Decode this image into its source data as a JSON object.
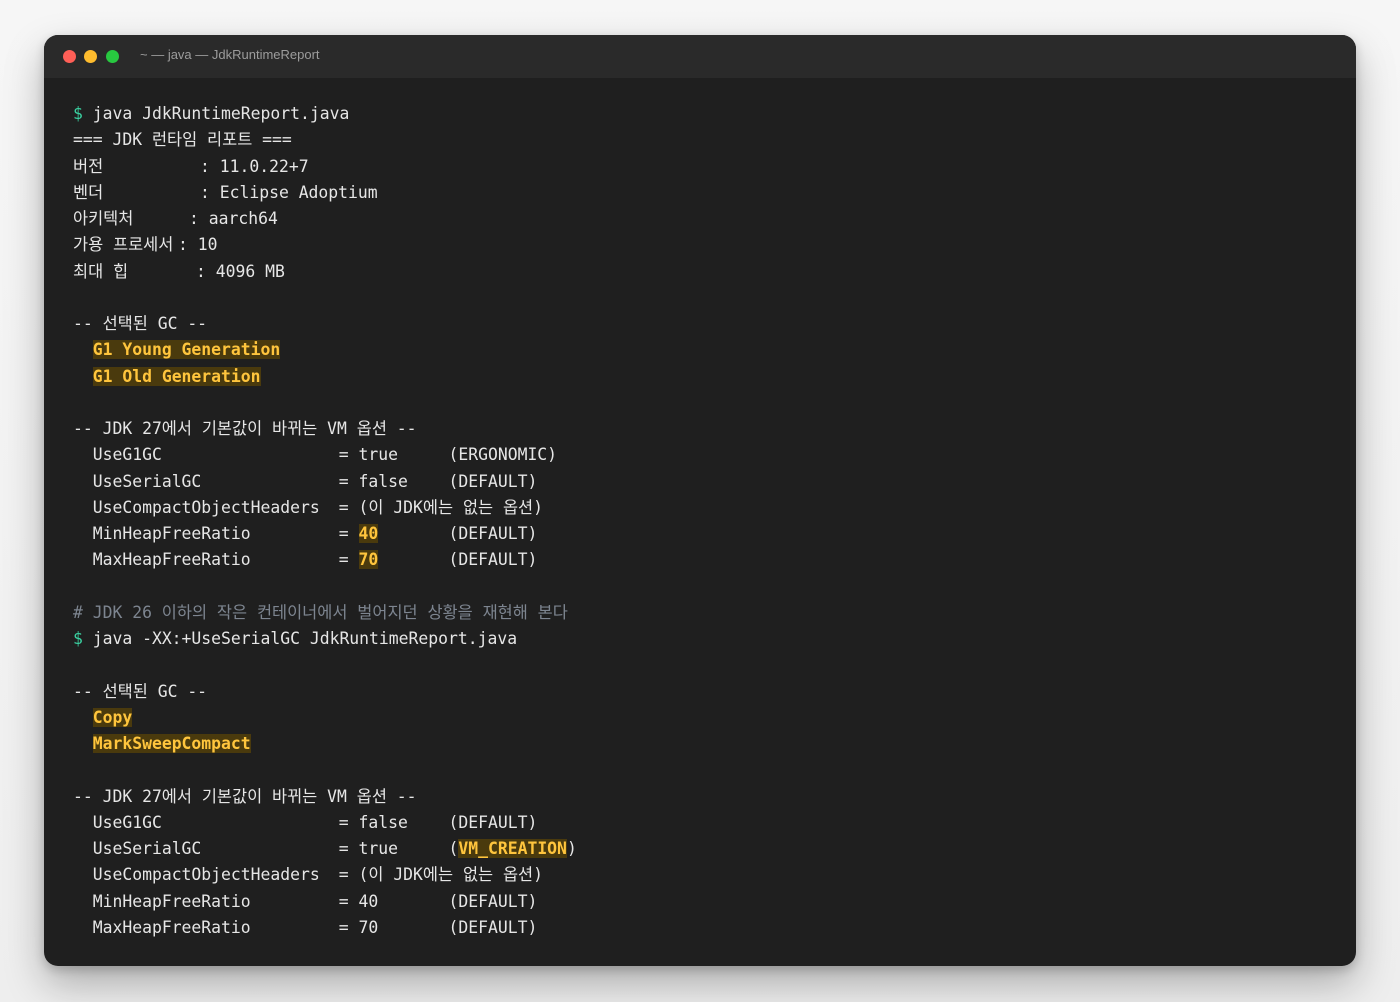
{
  "window": {
    "title": "~ — java — JdkRuntimeReport"
  },
  "terminal": {
    "cmd1": {
      "prompt": "$",
      "command": " java JdkRuntimeReport.java"
    },
    "report_header": "=== JDK 런타임 리포트 ===",
    "report": [
      {
        "label": "버전",
        "sep": ": ",
        "value": "11.0.22+7"
      },
      {
        "label": "벤더",
        "sep": ": ",
        "value": "Eclipse Adoptium"
      },
      {
        "label": "아키텍처",
        "sep": ": ",
        "value": "aarch64"
      },
      {
        "label": "가용 프로세서",
        "sep": ": ",
        "value": "10"
      },
      {
        "label": "최대 힙",
        "sep": ": ",
        "value": "4096 MB"
      }
    ],
    "gc_header_1": "-- 선택된 GC --",
    "gc_list_1": [
      "G1 Young Generation",
      "G1 Old Generation"
    ],
    "vm_header_1": "-- JDK 27에서 기본값이 바뀌는 VM 옵션 --",
    "vm_options_1": [
      {
        "name": "UseG1GC",
        "eq": "= ",
        "value": "true",
        "origin": "(ERGONOMIC)"
      },
      {
        "name": "UseSerialGC",
        "eq": "= ",
        "value": "false",
        "origin": "(DEFAULT)"
      },
      {
        "name": "UseCompactObjectHeaders",
        "eq": "= ",
        "value": "(이 JDK에는 없는 옵션)",
        "origin": ""
      },
      {
        "name": "MinHeapFreeRatio",
        "eq": "= ",
        "value": "40",
        "origin": "(DEFAULT)"
      },
      {
        "name": "MaxHeapFreeRatio",
        "eq": "= ",
        "value": "70",
        "origin": "(DEFAULT)"
      }
    ],
    "comment": "# JDK 26 이하의 작은 컨테이너에서 벌어지던 상황을 재현해 본다",
    "cmd2": {
      "prompt": "$",
      "command": " java -XX:+UseSerialGC JdkRuntimeReport.java"
    },
    "gc_header_2": "-- 선택된 GC --",
    "gc_list_2": [
      "Copy",
      "MarkSweepCompact"
    ],
    "vm_header_2": "-- JDK 27에서 기본값이 바뀌는 VM 옵션 --",
    "vm_options_2": [
      {
        "name": "UseG1GC",
        "eq": "= ",
        "value": "false",
        "origin": "(DEFAULT)"
      },
      {
        "name": "UseSerialGC",
        "eq": "= ",
        "value": "true",
        "origin_open": "(",
        "origin_hl": "VM_CREATION",
        "origin_close": ")"
      },
      {
        "name": "UseCompactObjectHeaders",
        "eq": "= ",
        "value": "(이 JDK에는 없는 옵션)",
        "origin": ""
      },
      {
        "name": "MinHeapFreeRatio",
        "eq": "= ",
        "value": "40",
        "origin": "(DEFAULT)"
      },
      {
        "name": "MaxHeapFreeRatio",
        "eq": "= ",
        "value": "70",
        "origin": "(DEFAULT)"
      }
    ]
  },
  "colors": {
    "background": "#1f1f1f",
    "prompt": "#3ad0a0",
    "highlight_text": "#ffc53d",
    "highlight_bg": "#4a3a0d",
    "comment": "#7d8590"
  }
}
